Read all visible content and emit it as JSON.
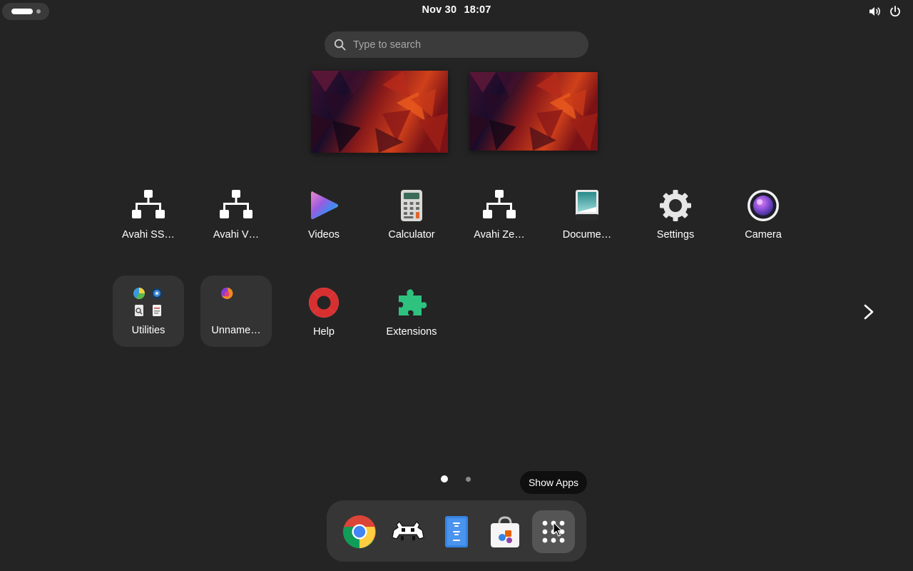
{
  "topbar": {
    "date": "Nov 30",
    "time": "18:07",
    "icons": [
      "activities-indicator",
      "volume-icon",
      "power-icon"
    ]
  },
  "search": {
    "placeholder": "Type to search",
    "icon": "search-icon"
  },
  "workspaces": {
    "count": 2
  },
  "apps": [
    {
      "label": "Avahi SS…",
      "icon": "network-icon"
    },
    {
      "label": "Avahi V…",
      "icon": "network-icon"
    },
    {
      "label": "Videos",
      "icon": "videos-icon"
    },
    {
      "label": "Calculator",
      "icon": "calculator-icon"
    },
    {
      "label": "Avahi Ze…",
      "icon": "network-icon"
    },
    {
      "label": "Docume…",
      "icon": "document-scanner-icon"
    },
    {
      "label": "Settings",
      "icon": "gear-icon"
    },
    {
      "label": "Camera",
      "icon": "camera-icon"
    },
    {
      "label": "Utilities",
      "icon": "folder-icon"
    },
    {
      "label": "Unname…",
      "icon": "folder-icon"
    },
    {
      "label": "Help",
      "icon": "lifebuoy-icon"
    },
    {
      "label": "Extensions",
      "icon": "puzzle-icon"
    }
  ],
  "pagination": {
    "pages": 2,
    "current": 1
  },
  "tooltip": {
    "text": "Show Apps"
  },
  "dash": {
    "items": [
      "chrome-icon",
      "retroarch-icon",
      "text-editor-icon",
      "software-icon",
      "show-apps-icon"
    ],
    "active": "show-apps-icon"
  },
  "colors": {
    "background": "#242424",
    "panel": "#363636",
    "search": "#3b3b3b",
    "folder": "#333333"
  }
}
